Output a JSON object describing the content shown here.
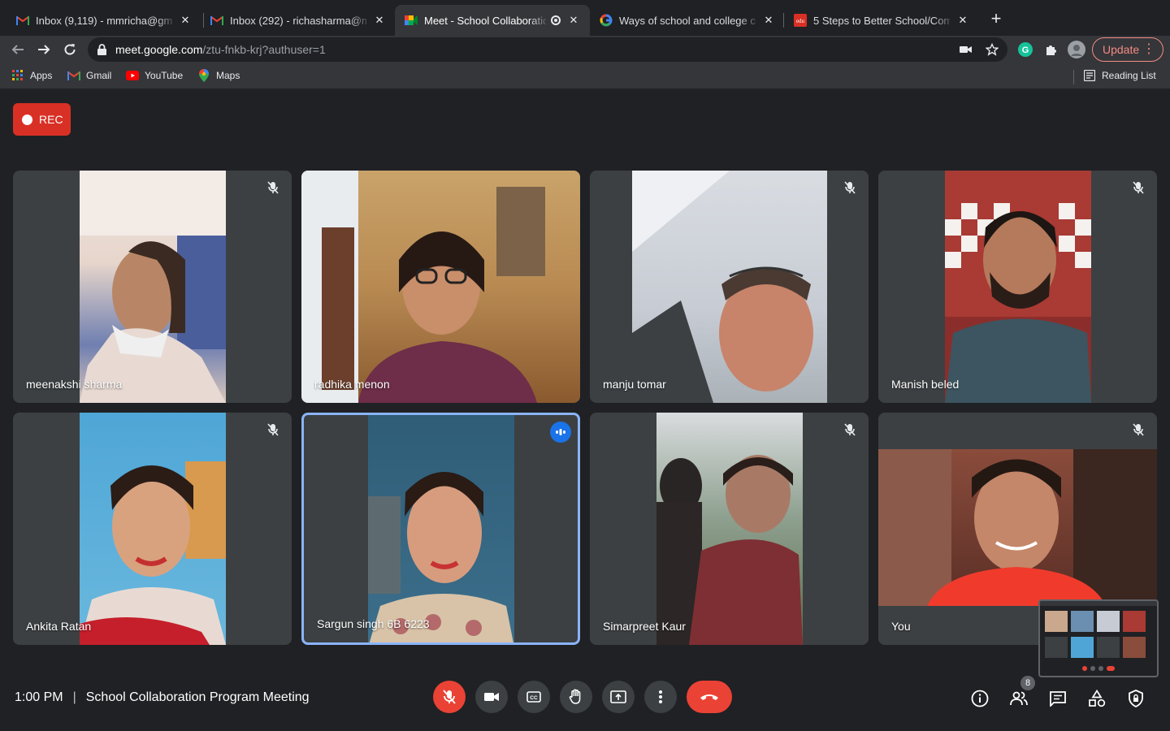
{
  "browser": {
    "tabs": [
      {
        "title": "Inbox (9,119) - mmricha@gmai",
        "favicon": "gmail-icon"
      },
      {
        "title": "Inbox (292) - richasharma@ms",
        "favicon": "gmail-icon"
      },
      {
        "title": "Meet - School Collaboratio",
        "favicon": "google-meet-icon",
        "active": true
      },
      {
        "title": "Ways of school and college co",
        "favicon": "google-icon"
      },
      {
        "title": "5 Steps to Better School/Comm",
        "favicon": "edu-icon"
      }
    ],
    "url_host": "meet.google.com",
    "url_path": "/ztu-fnkb-krj?authuser=1",
    "update_label": "Update",
    "bookmarks": [
      "Apps",
      "Gmail",
      "YouTube",
      "Maps"
    ],
    "reading_list": "Reading List"
  },
  "meet": {
    "rec_label": "REC",
    "participants": [
      {
        "name": "meenakshi sharma",
        "muted": true
      },
      {
        "name": "radhika menon",
        "muted": false
      },
      {
        "name": "manju tomar",
        "muted": true
      },
      {
        "name": "Manish beled",
        "muted": true
      },
      {
        "name": "Ankita Ratan",
        "muted": true
      },
      {
        "name": "Sargun singh 6B 6223",
        "speaking": true
      },
      {
        "name": "Simarpreet Kaur",
        "muted": true
      },
      {
        "name": "You",
        "muted": true
      }
    ],
    "time": "1:00 PM",
    "meeting_title": "School Collaboration Program Meeting",
    "participant_count": "8"
  },
  "colors": {
    "background": "#202124",
    "tile": "#3c4043",
    "danger": "#ea4335",
    "speaking_border": "#8ab4f8",
    "update": "#f28b82"
  }
}
